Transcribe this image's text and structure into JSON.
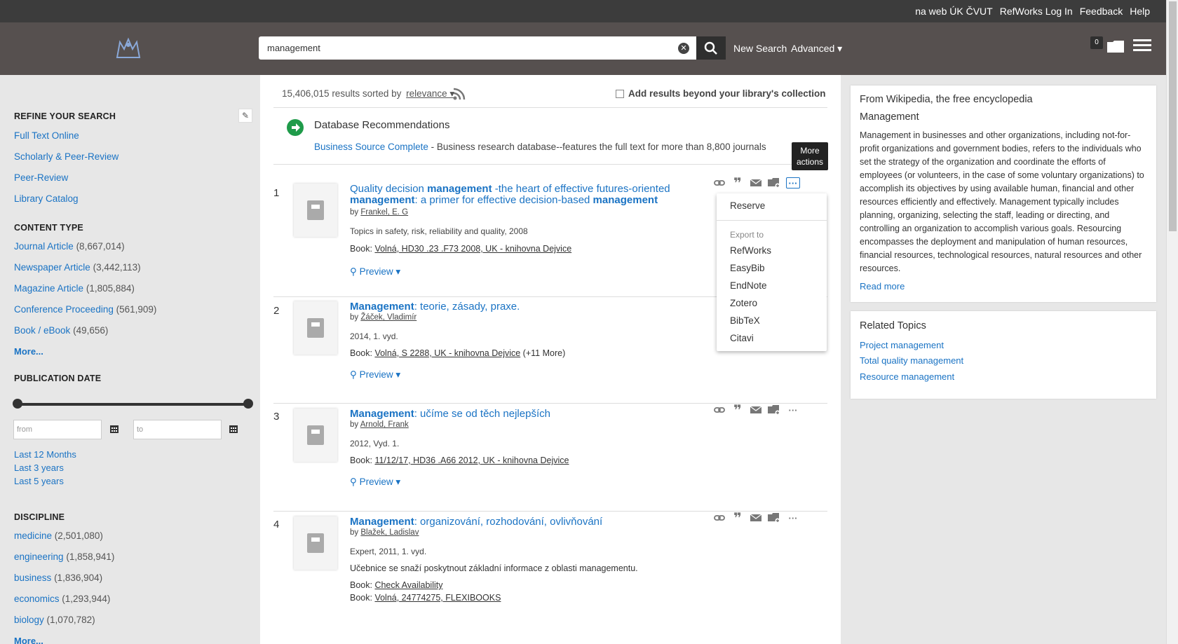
{
  "top_links": [
    "na web ÚK ČVUT",
    "RefWorks Log In",
    "Feedback",
    "Help"
  ],
  "search": {
    "value": "management",
    "new_search": "New Search",
    "advanced": "Advanced ▾"
  },
  "cart": {
    "count": "0"
  },
  "sidebar": {
    "refine_heading": "REFINE YOUR SEARCH",
    "refine_links": [
      "Full Text Online",
      "Scholarly & Peer-Review",
      "Peer-Review",
      "Library Catalog"
    ],
    "content_type_heading": "CONTENT TYPE",
    "content_types": [
      {
        "label": "Journal Article",
        "count": "(8,667,014)"
      },
      {
        "label": "Newspaper Article",
        "count": "(3,442,113)"
      },
      {
        "label": "Magazine Article",
        "count": "(1,805,884)"
      },
      {
        "label": "Conference Proceeding",
        "count": "(561,909)"
      },
      {
        "label": "Book / eBook",
        "count": "(49,656)"
      }
    ],
    "more": "More...",
    "pubdate_heading": "PUBLICATION DATE",
    "from_placeholder": "from",
    "to_placeholder": "to",
    "date_links": [
      "Last 12 Months",
      "Last 3 years",
      "Last 5 years"
    ],
    "discipline_heading": "DISCIPLINE",
    "disciplines": [
      {
        "label": "medicine",
        "count": "(2,501,080)"
      },
      {
        "label": "engineering",
        "count": "(1,858,941)"
      },
      {
        "label": "business",
        "count": "(1,836,904)"
      },
      {
        "label": "economics",
        "count": "(1,293,944)"
      },
      {
        "label": "biology",
        "count": "(1,070,782)"
      }
    ],
    "more2": "More..."
  },
  "results_bar": {
    "count_text": "15,406,015 results sorted by",
    "sort": "relevance ▾",
    "beyond": "Add results beyond your library's collection"
  },
  "dbrec": {
    "title": "Database Recommendations",
    "link": "Business Source Complete",
    "desc": " - Business research database--features the full text for more than 8,800 journals"
  },
  "results": [
    {
      "num": "1",
      "title_html_parts": [
        "Quality decision ",
        "management",
        " -the heart of effective futures-oriented ",
        "management",
        ": a primer for effective decision-based ",
        "management"
      ],
      "by": "Frankel, E. G",
      "meta": "Topics in safety, risk, reliability and quality, 2008",
      "book": "Volná, HD30 .23 .F73 2008, UK - knihovna Dejvice",
      "book_extra": "",
      "preview": "Preview ▾"
    },
    {
      "num": "2",
      "title_html_parts": [
        "Management",
        ": teorie, zásady, praxe."
      ],
      "by": "Žáček, Vladimír",
      "meta": "2014, 1. vyd.",
      "book": "Volná, S 2288, UK - knihovna Dejvice",
      "book_extra": " (+11 More)",
      "preview": "Preview ▾"
    },
    {
      "num": "3",
      "title_html_parts": [
        "Management",
        ": učíme se od těch nejlepších"
      ],
      "by": "Arnold, Frank",
      "meta": "2012, Vyd. 1.",
      "book": "11/12/17, HD36 .A66 2012, UK - knihovna Dejvice",
      "book_extra": "",
      "preview": "Preview ▾"
    },
    {
      "num": "4",
      "title_html_parts": [
        "Management",
        ": organizování, rozhodování, ovlivňování"
      ],
      "by": "Blažek, Ladislav",
      "meta": "Expert, 2011, 1. vyd.",
      "abstract": "Učebnice se snaží poskytnout základní informace z oblasti managementu.",
      "book": "Check Availability",
      "book2": "Volná, 24774275, FLEXIBOOKS"
    }
  ],
  "book_prefix": "Book: ",
  "by_prefix": "by ",
  "tooltip": "More actions",
  "dropdown": {
    "reserve": "Reserve",
    "export_label": "Export to",
    "items": [
      "RefWorks",
      "EasyBib",
      "EndNote",
      "Zotero",
      "BibTeX",
      "Citavi"
    ]
  },
  "wiki": {
    "source": "From Wikipedia, the free encyclopedia",
    "title": "Management",
    "text": "Management in businesses and other organizations, including not-for-profit organizations and government bodies, refers to the individuals who set the strategy of the organization and coordinate the efforts of employees (or volunteers, in the case of some voluntary organizations) to accomplish its objectives by using available human, financial and other resources efficiently and effectively. Management typically includes planning, organizing, selecting the staff, leading or directing, and controlling an organization to accomplish various goals. Resourcing encompasses the deployment and manipulation of human resources, financial resources, technological resources, natural resources and other resources.",
    "read_more": "Read more"
  },
  "related": {
    "heading": "Related Topics",
    "items": [
      "Project management",
      "Total quality management",
      "Resource management"
    ]
  }
}
